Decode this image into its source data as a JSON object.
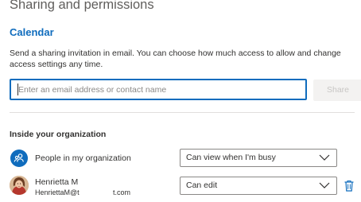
{
  "header": {
    "title": "Sharing and permissions"
  },
  "calendar": {
    "name": "Calendar",
    "description": "Send a sharing invitation in email. You can choose how much access to allow and change access settings any time."
  },
  "invite": {
    "placeholder": "Enter an email address or contact name",
    "value": "",
    "share_label": "Share"
  },
  "organization": {
    "heading": "Inside your organization",
    "rows": [
      {
        "name": "People in my organization",
        "icon": "people-icon",
        "permission": "Can view when I'm busy"
      },
      {
        "name": "Henrietta M",
        "email": "HenriettaM@t",
        "email_suffix": "t.com",
        "icon": "avatar",
        "permission": "Can edit"
      }
    ]
  },
  "colors": {
    "accent": "#0f6cbd",
    "text": "#323130",
    "muted": "#605e5c",
    "border": "#8a8886"
  }
}
